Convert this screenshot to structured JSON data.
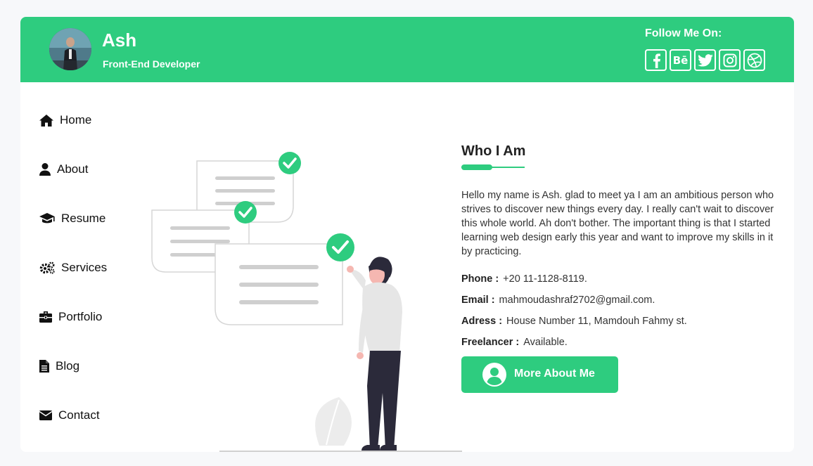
{
  "profile": {
    "name": "Ash",
    "role": "Front-End Developer"
  },
  "follow": {
    "title": "Follow Me On:",
    "icons": [
      "facebook-icon",
      "behance-icon",
      "twitter-icon",
      "instagram-icon",
      "dribbble-icon"
    ],
    "behance_text": "Bē"
  },
  "nav": {
    "items": [
      {
        "label": "Home",
        "icon": "home-icon"
      },
      {
        "label": "About",
        "icon": "user-icon"
      },
      {
        "label": "Resume",
        "icon": "graduation-cap-icon"
      },
      {
        "label": "Services",
        "icon": "gears-icon"
      },
      {
        "label": "Portfolio",
        "icon": "briefcase-icon"
      },
      {
        "label": "Blog",
        "icon": "file-icon"
      },
      {
        "label": "Contact",
        "icon": "envelope-icon"
      }
    ]
  },
  "about": {
    "title": "Who I Am",
    "bio": "Hello my name is Ash. glad to meet ya I am an ambitious person who strives to discover new things every day. I really can't wait to discover this whole world. Ah don't bother. The important thing is that I started learning web design early this year and want to improve my skills in it by practicing.",
    "phone_label": "Phone :",
    "phone": "+20 11-1128-8119.",
    "email_label": "Email :",
    "email": "mahmoudashraf2702@gmail.com.",
    "address_label": "Adress :",
    "address": "House Number 11, Mamdouh Fahmy st.",
    "freelancer_label": "Freelancer :",
    "freelancer": "Available.",
    "button_label": "More About Me"
  },
  "colors": {
    "accent": "#2ecc7f",
    "text": "#222222",
    "background": "#f7f8fa"
  }
}
